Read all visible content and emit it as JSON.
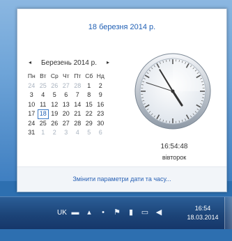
{
  "flyout": {
    "date_header": "18 березня 2014 р.",
    "calendar": {
      "prev_label": "◂",
      "next_label": "▸",
      "month_label": "Березень 2014 р.",
      "weekdays": [
        "Пн",
        "Вт",
        "Ср",
        "Чт",
        "Пт",
        "Сб",
        "Нд"
      ],
      "weeks": [
        [
          "24",
          "25",
          "26",
          "27",
          "28",
          "1",
          "2"
        ],
        [
          "3",
          "4",
          "5",
          "6",
          "7",
          "8",
          "9"
        ],
        [
          "10",
          "11",
          "12",
          "13",
          "14",
          "15",
          "16"
        ],
        [
          "17",
          "18",
          "19",
          "20",
          "21",
          "22",
          "23"
        ],
        [
          "24",
          "25",
          "26",
          "27",
          "28",
          "29",
          "30"
        ],
        [
          "31",
          "1",
          "2",
          "3",
          "4",
          "5",
          "6"
        ]
      ],
      "selected_day": "18"
    },
    "clock": {
      "time": "16:54:48",
      "day": "вівторок"
    },
    "footer_link": "Змінити параметри дати та часу..."
  },
  "taskbar": {
    "language": "UK",
    "tray_icons": [
      "keyboard-icon",
      "chevron-up-icon",
      "flag-icon",
      "network-icon",
      "volume-icon"
    ],
    "time": "16:54",
    "date": "18.03.2014"
  }
}
